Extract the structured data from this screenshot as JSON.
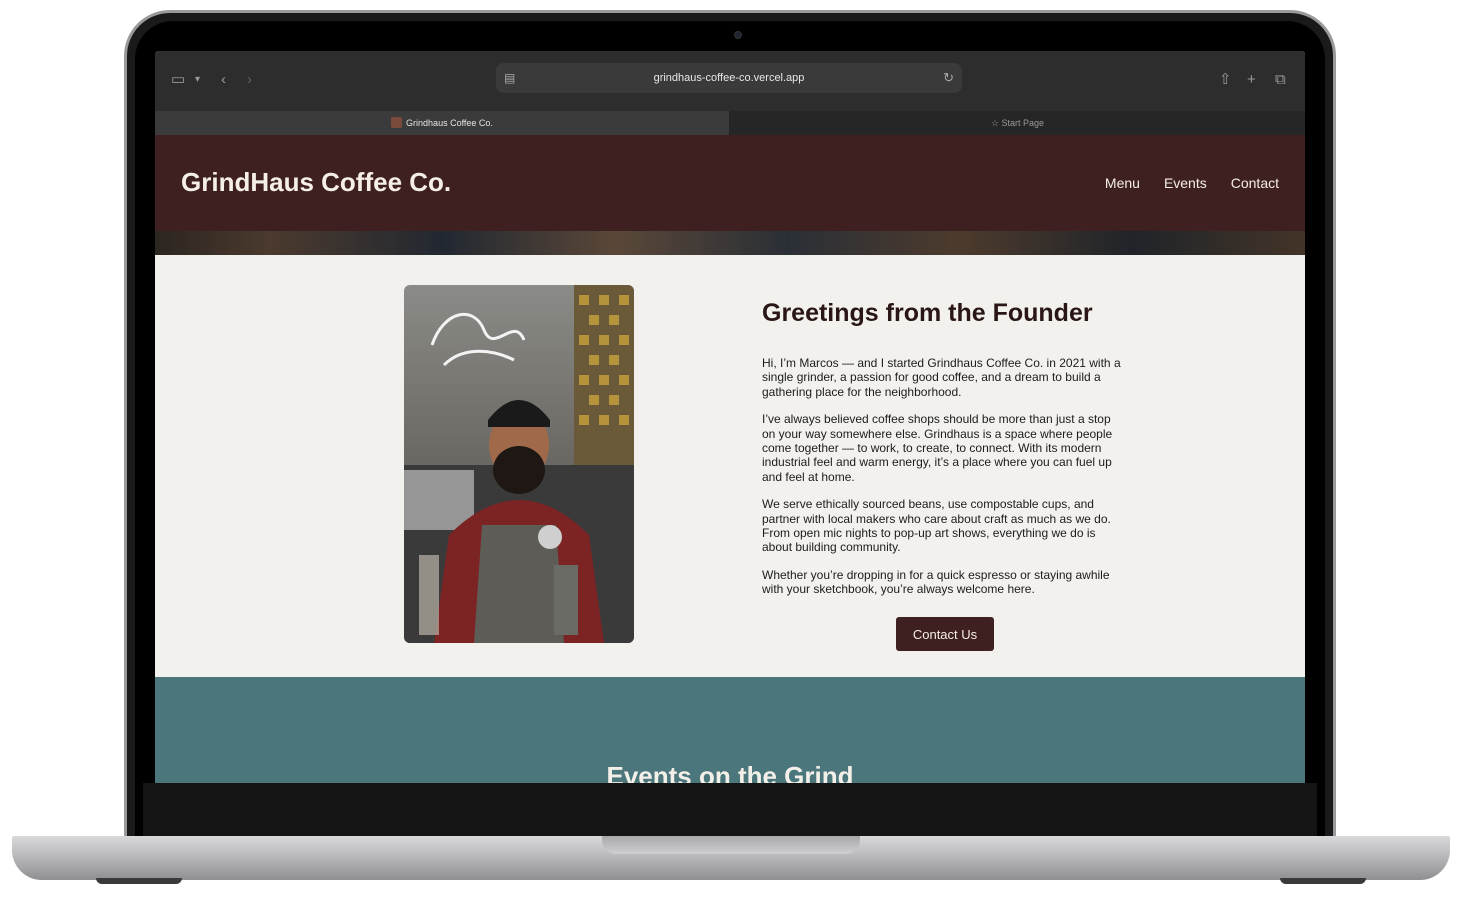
{
  "browser": {
    "url": "grindhaus-coffee-co.vercel.app",
    "tabs": [
      {
        "label": "Grindhaus Coffee Co.",
        "active": true
      },
      {
        "label": "Start Page",
        "active": false
      }
    ],
    "icons": {
      "sidebar": "sidebar-icon",
      "back": "chevron-left-icon",
      "forward": "chevron-right-icon",
      "share": "share-icon",
      "new_tab": "plus-icon",
      "tabs_overview": "tabs-icon"
    }
  },
  "site": {
    "logo": "GrindHaus Coffee Co.",
    "nav": [
      "Menu",
      "Events",
      "Contact"
    ],
    "about": {
      "title": "Greetings from the Founder",
      "paragraphs": [
        "Hi, I’m Marcos — and I started Grindhaus Coffee Co. in 2021 with a single grinder, a passion for good coffee, and a dream to build a gathering place for the neighborhood.",
        "I’ve always believed coffee shops should be more than just a stop on your way somewhere else. Grindhaus is a space where people come together — to work, to create, to connect. With its modern industrial feel and warm energy, it’s a place where you can fuel up and feel at home.",
        "We serve ethically sourced beans, use compostable cups, and partner with local makers who care about craft as much as we do. From open mic nights to pop-up art shows, everything we do is about building community.",
        "Whether you’re dropping in for a quick espresso or staying awhile with your sketchbook, you’re always welcome here."
      ],
      "button": "Contact Us"
    },
    "events": {
      "title": "Events on the Grind"
    },
    "colors": {
      "header": "#3e2020",
      "background": "#f2f1ed",
      "events": "#4b767c"
    }
  }
}
